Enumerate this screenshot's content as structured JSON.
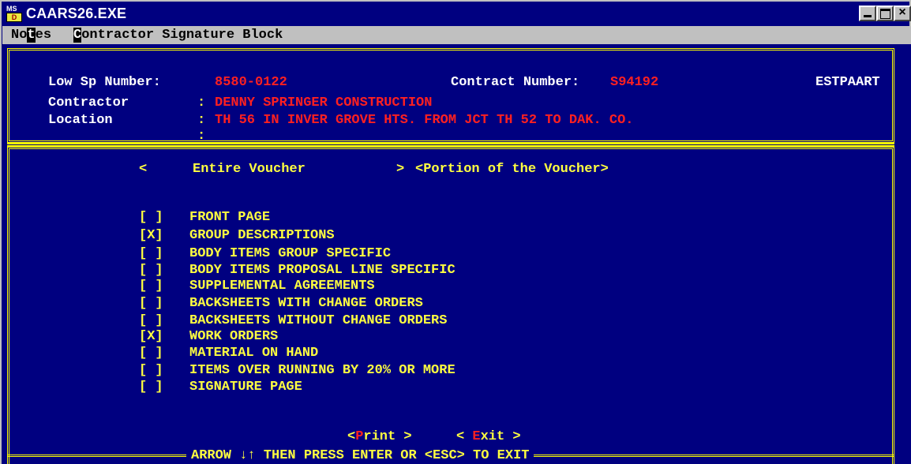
{
  "window": {
    "title": "CAARS26.EXE",
    "icon": "ms-dos-icon"
  },
  "menu": {
    "notes_label": "Notes",
    "csb_label": "Contractor Signature Block"
  },
  "header": {
    "low_sp_label": "Low Sp Number:",
    "low_sp_value": "8580-0122",
    "contract_label": "Contract Number:",
    "contract_value": "S94192",
    "screen_code": "ESTPAART",
    "contractor_label": "Contractor",
    "contractor_value": "DENNY SPRINGER CONSTRUCTION",
    "location_label": "Location",
    "location_value": "TH 56 IN INVER GROVE HTS. FROM JCT TH 52 TO DAK. CO.",
    "colon": ":"
  },
  "choice": {
    "entire_left": "<",
    "entire_label": "Entire Voucher",
    "entire_right": ">",
    "portion_label": "<Portion of the Voucher>"
  },
  "options": [
    {
      "mark": "[ ]",
      "label": "FRONT PAGE"
    },
    {
      "mark": "[X]",
      "label": "GROUP DESCRIPTIONS"
    },
    {
      "mark": "[ ]",
      "label": "BODY ITEMS GROUP SPECIFIC"
    },
    {
      "mark": "[ ]",
      "label": "BODY ITEMS PROPOSAL LINE SPECIFIC"
    },
    {
      "mark": "[ ]",
      "label": "SUPPLEMENTAL AGREEMENTS"
    },
    {
      "mark": "[ ]",
      "label": "BACKSHEETS WITH CHANGE ORDERS"
    },
    {
      "mark": "[ ]",
      "label": "BACKSHEETS WITHOUT CHANGE ORDERS"
    },
    {
      "mark": "[X]",
      "label": "WORK ORDERS"
    },
    {
      "mark": "[ ]",
      "label": "MATERIAL ON HAND"
    },
    {
      "mark": "[ ]",
      "label": "ITEMS OVER RUNNING BY 20% OR MORE"
    },
    {
      "mark": "[ ]",
      "label": "SIGNATURE PAGE"
    }
  ],
  "actions": {
    "print_open": "<",
    "print_hot": "P",
    "print_rest": "rint >",
    "exit_open": "< ",
    "exit_hot": "E",
    "exit_rest": "xit >"
  },
  "footer": {
    "hint": "ARROW ↓↑ THEN PRESS ENTER OR <ESC> TO EXIT"
  }
}
